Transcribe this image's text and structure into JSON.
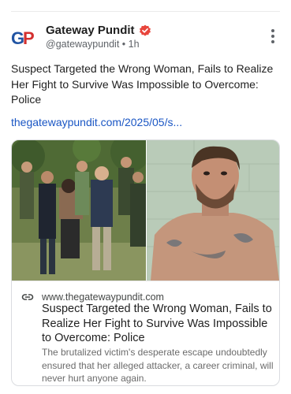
{
  "account": {
    "name": "Gateway Pundit",
    "handle": "@gatewaypundit",
    "separator": "•",
    "time": "1h",
    "avatar_initials": "GP"
  },
  "post": {
    "text": "Suspect Targeted the Wrong Woman, Fails to Realize Her Fight to Survive Was Impossible to Overcome: Police",
    "link_text": "thegatewaypundit.com/2025/05/s..."
  },
  "link_card": {
    "domain": "www.thegatewaypundit.com",
    "title": "Suspect Targeted the Wrong Woman, Fails to Realize Her Fight to Survive Was Impossible to Overcome: Police",
    "description": "The brutalized victim's desperate escape undoubtedly ensured that her alleged attacker, a career criminal, will never hurt anyone again."
  },
  "colors": {
    "link": "#1a56c4",
    "verified": "#e8453c",
    "avatar_blue": "#2154a3",
    "avatar_red": "#d3302f"
  },
  "icons": {
    "verified": "verified-badge-icon",
    "more": "more-vertical-icon",
    "link": "link-icon"
  }
}
